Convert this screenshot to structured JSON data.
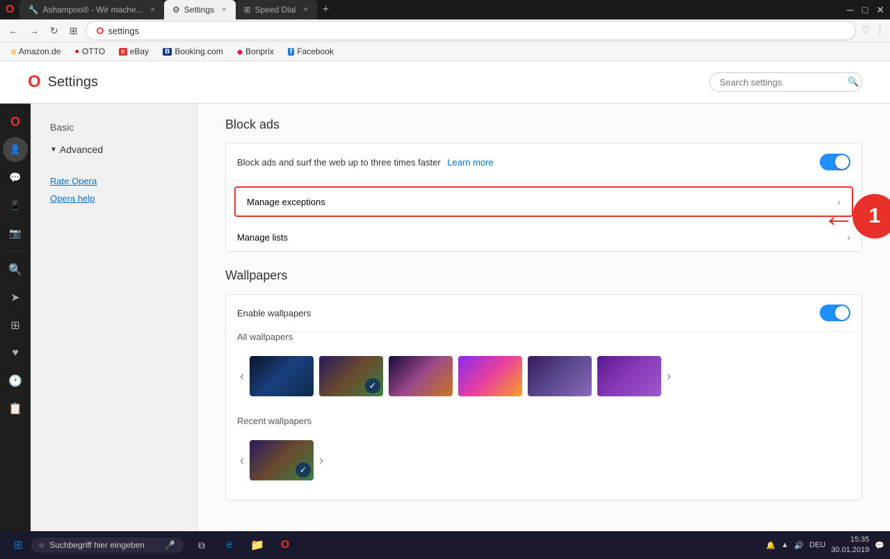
{
  "browser": {
    "tabs": [
      {
        "id": "ashampoo",
        "label": "Ashampoo® - Wir mache...",
        "active": false,
        "icon": "🔧"
      },
      {
        "id": "settings",
        "label": "Settings",
        "active": true,
        "icon": "⚙"
      },
      {
        "id": "speeddial",
        "label": "Speed Dial",
        "active": false,
        "icon": "⊞"
      }
    ],
    "address": "settings",
    "address_protocol": "opera"
  },
  "bookmarks": [
    {
      "id": "amazon",
      "label": "Amazon.de",
      "color": "#ff9900",
      "icon": "a"
    },
    {
      "id": "otto",
      "label": "OTTO",
      "color": "#cc0000",
      "icon": "●"
    },
    {
      "id": "ebay",
      "label": "eBay",
      "color": "#e43137",
      "icon": "e"
    },
    {
      "id": "booking",
      "label": "Booking.com",
      "color": "#003580",
      "icon": "B"
    },
    {
      "id": "bonprix",
      "label": "Bonprix",
      "color": "#e8005a",
      "icon": "b"
    },
    {
      "id": "facebook",
      "label": "Facebook",
      "color": "#1877f2",
      "icon": "f"
    }
  ],
  "settings": {
    "page_title": "Settings",
    "search_placeholder": "Search settings",
    "nav": {
      "basic_label": "Basic",
      "advanced_label": "Advanced",
      "advanced_expanded": true,
      "links": [
        {
          "id": "rate-opera",
          "label": "Rate Opera"
        },
        {
          "id": "opera-help",
          "label": "Opera help"
        }
      ]
    },
    "block_ads": {
      "section_title": "Block ads",
      "toggle_label": "Block ads and surf the web up to three times faster",
      "learn_more_label": "Learn more",
      "toggle_on": true,
      "manage_exceptions_label": "Manage exceptions",
      "manage_lists_label": "Manage lists"
    },
    "wallpapers": {
      "section_title": "Wallpapers",
      "enable_label": "Enable wallpapers",
      "toggle_on": true,
      "all_label": "All wallpapers",
      "recent_label": "Recent wallpapers",
      "wallpapers": [
        {
          "id": "wp1",
          "class": "wp-1",
          "selected": false
        },
        {
          "id": "wp2",
          "class": "wp-2",
          "selected": true
        },
        {
          "id": "wp3",
          "class": "wp-3",
          "selected": false
        },
        {
          "id": "wp4",
          "class": "wp-4",
          "selected": false
        },
        {
          "id": "wp5",
          "class": "wp-5",
          "selected": false
        },
        {
          "id": "wp6",
          "class": "wp-6",
          "selected": false
        }
      ],
      "recent_wallpapers": [
        {
          "id": "rwp1",
          "class": "wp-2",
          "selected": true
        }
      ]
    }
  },
  "annotation": {
    "number": "1",
    "color": "#e8312a"
  },
  "taskbar": {
    "search_placeholder": "Suchbegriff hier eingeben",
    "time": "15:35",
    "date": "30.01.2019",
    "language": "DEU"
  },
  "sidebar_icons": [
    {
      "id": "opera-logo",
      "symbol": "O",
      "label": "Opera logo"
    },
    {
      "id": "news",
      "symbol": "👤",
      "label": "News"
    },
    {
      "id": "messenger",
      "symbol": "💬",
      "label": "Messenger"
    },
    {
      "id": "whatsapp",
      "symbol": "📱",
      "label": "WhatsApp"
    },
    {
      "id": "camera",
      "symbol": "📷",
      "label": "Snapshot"
    },
    {
      "id": "search",
      "symbol": "🔍",
      "label": "Search"
    },
    {
      "id": "navigation",
      "symbol": "➤",
      "label": "My flow"
    },
    {
      "id": "dashboard",
      "symbol": "⊞",
      "label": "Dashboard"
    },
    {
      "id": "heart",
      "symbol": "♥",
      "label": "Bookmarks"
    },
    {
      "id": "history",
      "symbol": "🕐",
      "label": "History"
    },
    {
      "id": "extensions",
      "symbol": "📋",
      "label": "Extensions"
    }
  ]
}
